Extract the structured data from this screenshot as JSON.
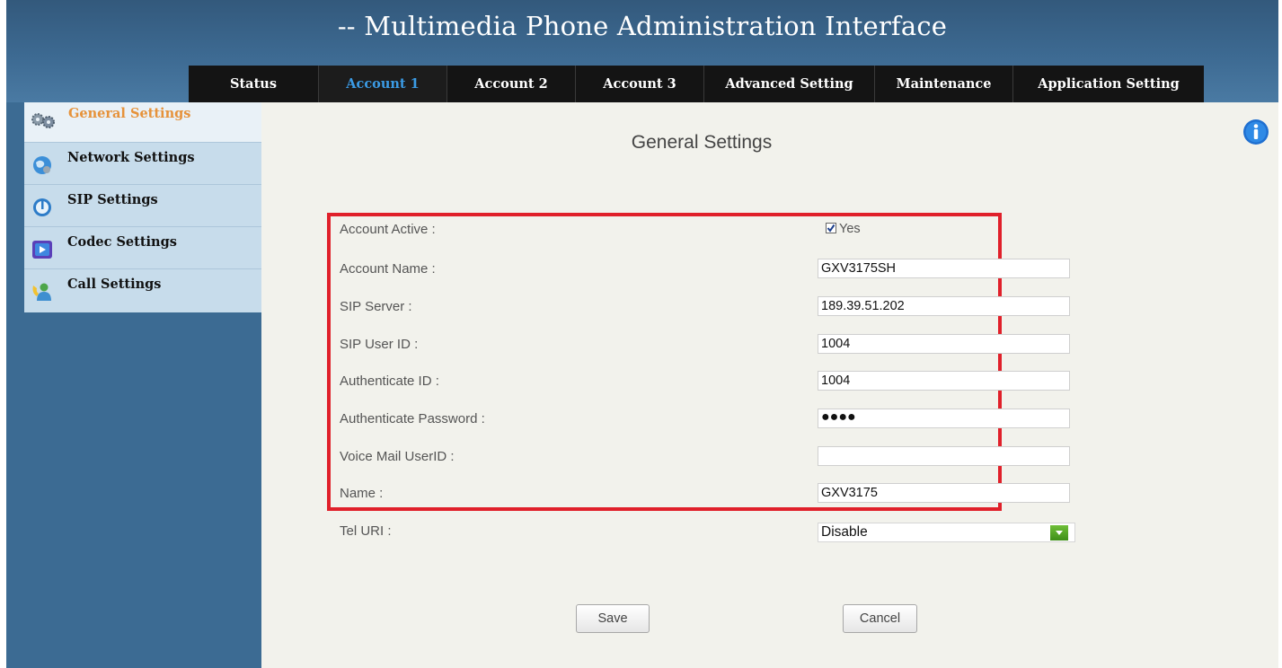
{
  "app": {
    "title": "-- Multimedia Phone Administration Interface"
  },
  "nav": {
    "tabs": [
      {
        "label": "Status"
      },
      {
        "label": "Account 1"
      },
      {
        "label": "Account 2"
      },
      {
        "label": "Account 3"
      },
      {
        "label": "Advanced Setting"
      },
      {
        "label": "Maintenance"
      },
      {
        "label": "Application Setting"
      }
    ],
    "active": "Account 1"
  },
  "sidebar": {
    "items": [
      {
        "label": "General Settings",
        "icon": "gears-icon"
      },
      {
        "label": "Network Settings",
        "icon": "globe-icon"
      },
      {
        "label": "SIP Settings",
        "icon": "sip-icon"
      },
      {
        "label": "Codec Settings",
        "icon": "codec-icon"
      },
      {
        "label": "Call Settings",
        "icon": "user-phone-icon"
      }
    ],
    "active": "General Settings"
  },
  "main": {
    "title": "General Settings",
    "form": {
      "account_active": {
        "label": "Account Active :",
        "checked": true,
        "option_label": "Yes"
      },
      "account_name": {
        "label": "Account Name :",
        "value": "GXV3175SH"
      },
      "sip_server": {
        "label": "SIP Server :",
        "value": "189.39.51.202"
      },
      "sip_user_id": {
        "label": "SIP User ID :",
        "value": "1004"
      },
      "authenticate_id": {
        "label": "Authenticate ID :",
        "value": "1004"
      },
      "authenticate_password": {
        "label": "Authenticate Password :",
        "value": "●●●●"
      },
      "voice_mail_user_id": {
        "label": "Voice Mail UserID :",
        "value": ""
      },
      "name": {
        "label": "Name :",
        "value": "GXV3175"
      },
      "tel_uri": {
        "label": "Tel URI :",
        "value": "Disable"
      }
    },
    "buttons": {
      "save": "Save",
      "cancel": "Cancel"
    }
  },
  "colors": {
    "header_blue": "#3d6a92",
    "nav_black": "#141414",
    "active_tab": "#3b9be5",
    "active_sidebar_text": "#e6923a",
    "highlight_border": "#e0202a",
    "select_arrow_green": "#4fa125"
  }
}
